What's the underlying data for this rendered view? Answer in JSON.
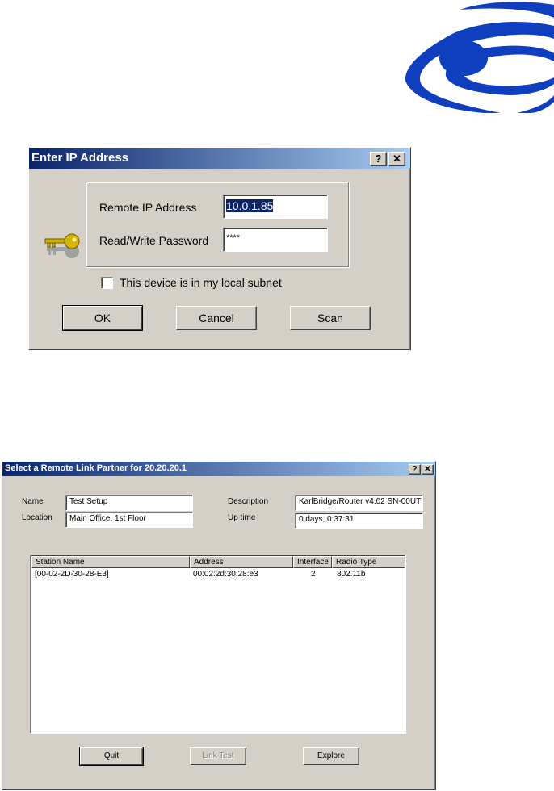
{
  "dialog_ip": {
    "title": "Enter IP Address",
    "help_label": "?",
    "close_label": "✕",
    "remote_ip_label": "Remote IP Address",
    "remote_ip_value": "10.0.1.85",
    "password_label": "Read/Write Password",
    "password_value": "****",
    "local_subnet_label": "This device is in my local subnet",
    "ok_label": "OK",
    "cancel_label": "Cancel",
    "scan_label": "Scan"
  },
  "dialog_partner": {
    "title": "Select a Remote Link Partner for 20.20.20.1",
    "help_label": "?",
    "close_label": "✕",
    "name_label": "Name",
    "name_value": "Test Setup",
    "location_label": "Location",
    "location_value": "Main Office, 1st Floor",
    "description_label": "Description",
    "description_value": "KarlBridge/Router v4.02 SN-00UT",
    "uptime_label": "Up time",
    "uptime_value": "0 days, 0:37:31",
    "columns": [
      "Station Name",
      "Address",
      "Interface",
      "Radio Type"
    ],
    "rows": [
      {
        "station": "[00-02-2D-30-28-E3]",
        "address": "00:02:2d:30:28:e3",
        "interface": "2",
        "radio": "802.11b"
      }
    ],
    "quit_label": "Quit",
    "link_test_label": "Link Test",
    "explore_label": "Explore"
  },
  "colors": {
    "logo_blue": "#0f3fbf",
    "title_start": "#0a246a",
    "title_end": "#a6caf0",
    "dialog_face": "#d4d0c8",
    "key_gold": "#d8b400"
  }
}
